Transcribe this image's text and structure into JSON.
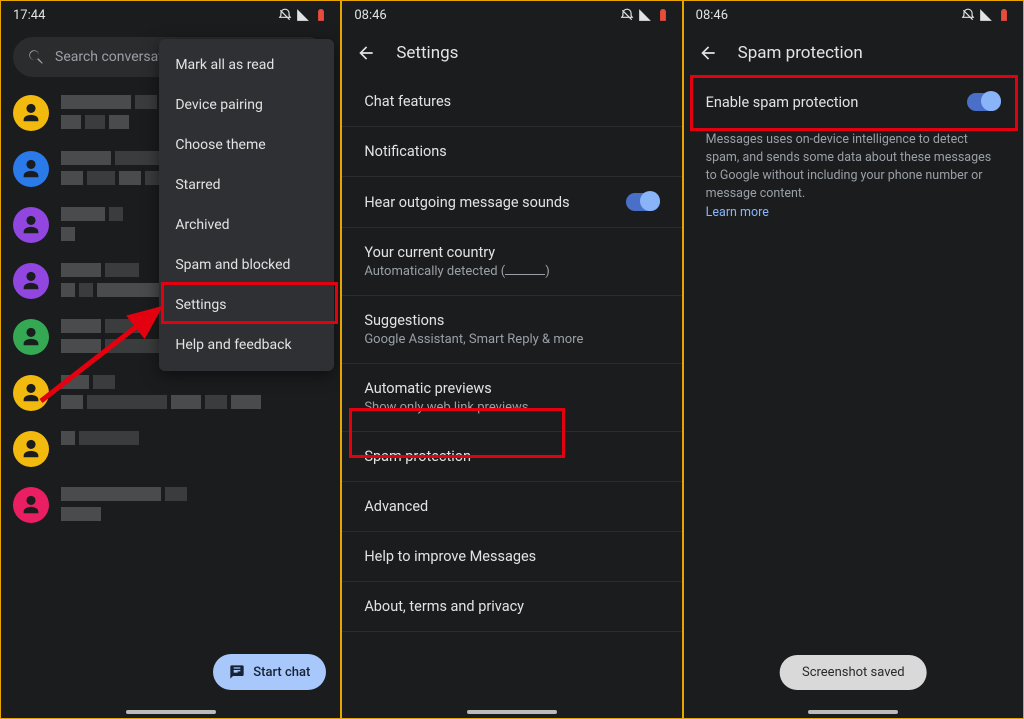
{
  "panel1": {
    "time": "17:44",
    "search_placeholder": "Search conversat",
    "menu": {
      "mark_all": "Mark all as read",
      "device_pairing": "Device pairing",
      "choose_theme": "Choose theme",
      "starred": "Starred",
      "archived": "Archived",
      "spam_blocked": "Spam and blocked",
      "settings": "Settings",
      "help": "Help and feedback"
    },
    "fab_label": "Start chat",
    "avatar_colors": [
      "#f2b90f",
      "#2a7aea",
      "#9146e0",
      "#9146e0",
      "#34a853",
      "#f2b90f",
      "#f2b90f",
      "#e91e63"
    ]
  },
  "panel2": {
    "time": "08:46",
    "title": "Settings",
    "rows": {
      "chat_features": "Chat features",
      "notifications": "Notifications",
      "hear_sounds": "Hear outgoing message sounds",
      "country_title": "Your current country",
      "country_sub_pre": "Automatically detected (",
      "country_sub_post": ")",
      "suggestions_title": "Suggestions",
      "suggestions_sub": "Google Assistant, Smart Reply & more",
      "auto_previews_title": "Automatic previews",
      "auto_previews_sub": "Show only web link previews",
      "spam_protection": "Spam protection",
      "advanced": "Advanced",
      "help_improve": "Help to improve Messages",
      "about": "About, terms and privacy"
    }
  },
  "panel3": {
    "time": "08:46",
    "title": "Spam protection",
    "enable_label": "Enable spam protection",
    "desc": "Messages uses on-device intelligence to detect spam, and sends some data about these messages to Google without including your phone number or message content.",
    "learn_more": "Learn more",
    "toast": "Screenshot saved"
  }
}
